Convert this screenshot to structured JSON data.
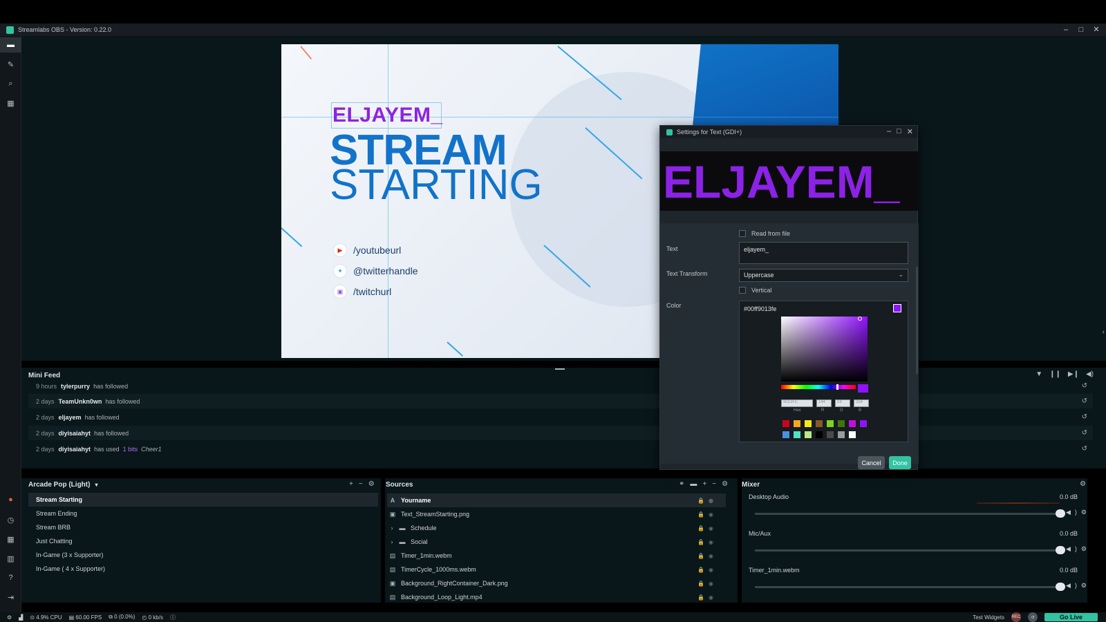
{
  "app": {
    "title": "Streamlabs OBS - Version: 0.22.0",
    "window_controls": [
      "–",
      "□",
      "✕"
    ]
  },
  "sidebar": {
    "items": [
      {
        "icon": "studio-icon",
        "glyph": "▬"
      },
      {
        "icon": "tools-icon",
        "glyph": "✎"
      },
      {
        "icon": "search-icon",
        "glyph": "⌕"
      },
      {
        "icon": "store-icon",
        "glyph": "▦"
      }
    ],
    "bottom_items": [
      {
        "icon": "record-icon",
        "glyph": "●"
      },
      {
        "icon": "stats-icon",
        "glyph": "◷"
      },
      {
        "icon": "layout-icon",
        "glyph": "▦"
      },
      {
        "icon": "columns-icon",
        "glyph": "▥"
      },
      {
        "icon": "help-icon",
        "glyph": "?"
      },
      {
        "icon": "logout-icon",
        "glyph": "⇥"
      },
      {
        "icon": "settings-icon",
        "glyph": "⚙"
      }
    ]
  },
  "canvas": {
    "name_text": "ELJAYEM_",
    "headline1": "STREAM",
    "headline2": "STARTING",
    "socials": [
      {
        "icon": "youtube-icon",
        "glyph": "▶",
        "color": "#e62117",
        "label": "/youtubeurl"
      },
      {
        "icon": "twitter-icon",
        "glyph": "✦",
        "color": "#1da1f2",
        "label": "@twitterhandle"
      },
      {
        "icon": "twitch-icon",
        "glyph": "▣",
        "color": "#8f5ad6",
        "label": "/twitchurl"
      }
    ],
    "accent_purple": "#9013fe",
    "accent_blue": "#1273c9"
  },
  "dialog": {
    "title": "Settings for Text (GDI+)",
    "window_controls": [
      "–",
      "□",
      "✕"
    ],
    "preview_text": "ELJAYEM_",
    "read_from_file_label": "Read from file",
    "text_label": "Text",
    "text_value": "eljayem_",
    "transform_label": "Text Transform",
    "transform_value": "Uppercase",
    "vertical_label": "Vertical",
    "color_label": "Color",
    "color_value": "#00ff9013fe",
    "picker": {
      "hex_field": "9013FE",
      "r_field": "144",
      "g_field": "19",
      "b_field": "254",
      "labels": [
        "Hex",
        "R",
        "G",
        "B"
      ],
      "presets_row1": [
        "#d0021b",
        "#f5a623",
        "#f8e71c",
        "#8b572a",
        "#7ed321",
        "#417505",
        "#bd10e0",
        "#9013fe"
      ],
      "presets_row2": [
        "#4a90e2",
        "#50e3c2",
        "#b8e986",
        "#000000",
        "#4a4a4a",
        "#9b9b9b",
        "#ffffff"
      ]
    },
    "cancel_label": "Cancel",
    "done_label": "Done"
  },
  "minifeed": {
    "title": "Mini Feed",
    "rows": [
      {
        "time": "9 hours",
        "user": "tylerpurry",
        "action": "has followed",
        "bits": "",
        "cheer": ""
      },
      {
        "time": "2 days",
        "user": "TeamUnkn0wn",
        "action": "has followed",
        "bits": "",
        "cheer": ""
      },
      {
        "time": "2 days",
        "user": "eljayem",
        "action": "has followed",
        "bits": "",
        "cheer": ""
      },
      {
        "time": "2 days",
        "user": "diyisaiahyt",
        "action": "has followed",
        "bits": "",
        "cheer": ""
      },
      {
        "time": "2 days",
        "user": "diyisaiahyt",
        "action": "has used",
        "bits": "1 bits",
        "cheer": "Cheer1"
      }
    ]
  },
  "scenes": {
    "collection": "Arcade Pop (Light)",
    "items": [
      "Stream Starting",
      "Stream Ending",
      "Stream BRB",
      "Just Chatting",
      "In-Game (3 x Supporter)",
      "In-Game ( 4 x Supporter)"
    ],
    "active_index": 0
  },
  "sources": {
    "title": "Sources",
    "items": [
      {
        "name": "Yourname",
        "icon": "text-icon",
        "glyph": "A",
        "folder": false
      },
      {
        "name": "Text_StreamStarting.png",
        "icon": "image-icon",
        "glyph": "▣",
        "folder": false
      },
      {
        "name": "Schedule",
        "icon": "folder-icon",
        "glyph": "▬",
        "folder": true
      },
      {
        "name": "Social",
        "icon": "folder-icon",
        "glyph": "▬",
        "folder": true
      },
      {
        "name": "Timer_1min.webm",
        "icon": "media-icon",
        "glyph": "▤",
        "folder": false
      },
      {
        "name": "TimerCycle_1000ms.webm",
        "icon": "media-icon",
        "glyph": "▤",
        "folder": false
      },
      {
        "name": "Background_RightContainer_Dark.png",
        "icon": "image-icon",
        "glyph": "▣",
        "folder": false
      },
      {
        "name": "Background_Loop_Light.mp4",
        "icon": "media-icon",
        "glyph": "▤",
        "folder": false
      }
    ]
  },
  "mixer": {
    "title": "Mixer",
    "channels": [
      {
        "name": "Desktop Audio",
        "db": "0.0 dB",
        "level": 1.0
      },
      {
        "name": "Mic/Aux",
        "db": "0.0 dB",
        "level": 1.0
      },
      {
        "name": "Timer_1min.webm",
        "db": "0.0 dB",
        "level": 1.0
      }
    ]
  },
  "status": {
    "cpu": "4.9% CPU",
    "fps": "60.00 FPS",
    "dropped": "0 (0.0%)",
    "bitrate": "0 kb/s",
    "test_widgets": "Test Widgets",
    "rec": "REC",
    "go_live": "Go Live"
  }
}
